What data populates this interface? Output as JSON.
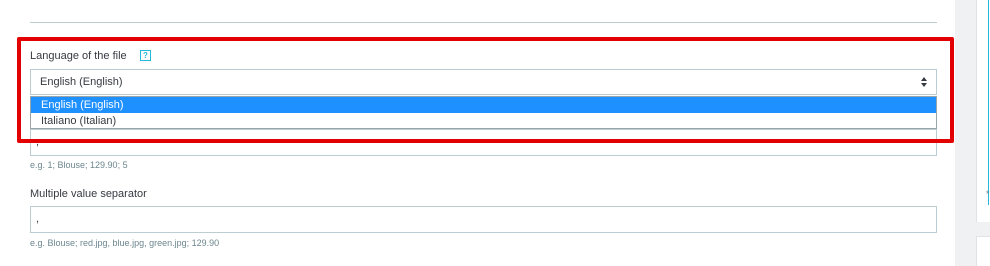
{
  "language_field": {
    "label": "Language of the file",
    "help_icon": "help-icon",
    "help_glyph": "?",
    "selected_value": "English (English)",
    "options": [
      "English (English)",
      "Italiano (Italian)"
    ]
  },
  "field_separator": {
    "value": ";",
    "hint": "e.g. 1; Blouse; 129.90; 5"
  },
  "multiple_value_separator": {
    "label": "Multiple value separator",
    "value": ",",
    "hint": "e.g. Blouse; red.jpg, blue.jpg, green.jpg; 129.90"
  },
  "right_card": {
    "asterisk": "*"
  },
  "colors": {
    "highlight": "#e20000",
    "accent": "#25b9d7",
    "selected_option": "#1e90ff"
  }
}
